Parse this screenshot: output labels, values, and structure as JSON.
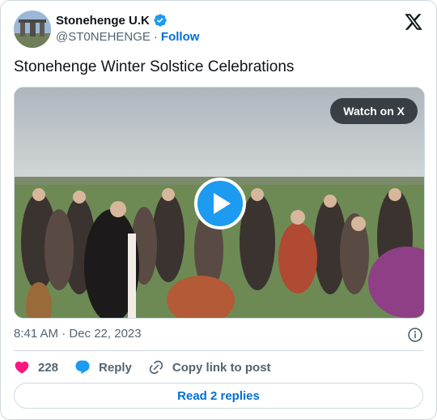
{
  "author": {
    "display_name": "Stonehenge U.K",
    "handle": "@ST0NEHENGE",
    "separator": "·",
    "follow_label": "Follow",
    "verified": true
  },
  "tweet": {
    "text": "Stonehenge Winter Solstice Celebrations"
  },
  "media": {
    "watch_label": "Watch on X",
    "type": "video",
    "play_icon": "play-icon"
  },
  "meta": {
    "timestamp": "8:41 AM · Dec 22, 2023",
    "info_icon": "info-icon"
  },
  "actions": {
    "like_count": "228",
    "reply_label": "Reply",
    "copy_label": "Copy link to post"
  },
  "footer": {
    "read_replies_label": "Read 2 replies"
  },
  "colors": {
    "accent": "#1d9bf0",
    "link": "#006fd6",
    "like": "#f91880",
    "text": "#0f1419",
    "muted": "#536471",
    "border": "#cfd9de"
  }
}
